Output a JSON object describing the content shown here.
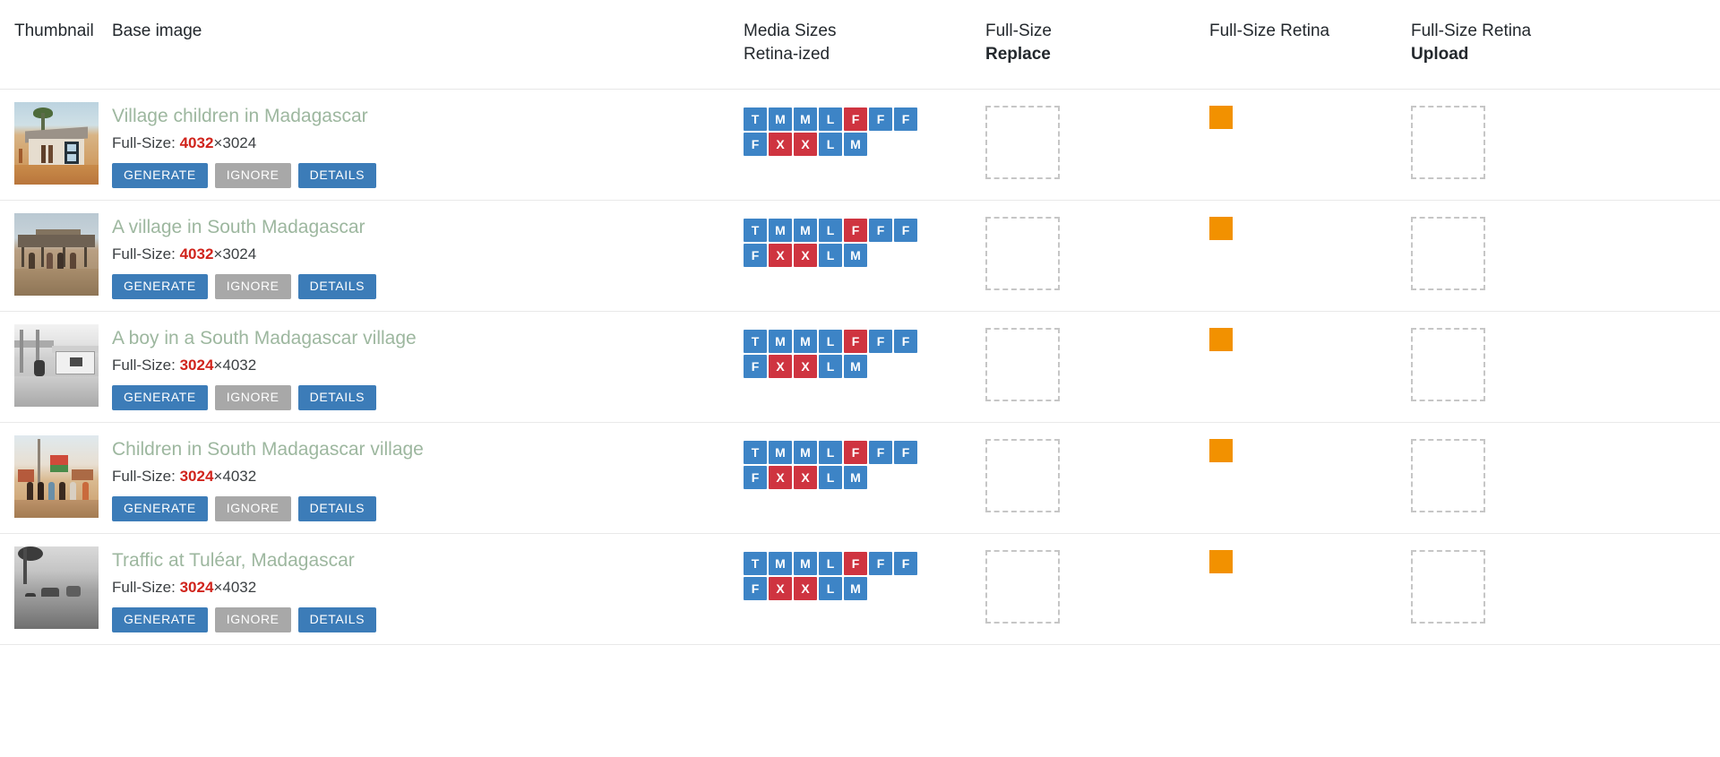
{
  "table": {
    "columns": [
      {
        "id": "thumbnail",
        "label": "Thumbnail",
        "sub": ""
      },
      {
        "id": "base_image",
        "label": "Base image",
        "sub": ""
      },
      {
        "id": "media_sizes",
        "label": "Media Sizes",
        "sub": "Retina-ized"
      },
      {
        "id": "full_size_replace",
        "label": "Full-Size",
        "sub": "Replace"
      },
      {
        "id": "full_size_retina",
        "label": "Full-Size Retina",
        "sub": ""
      },
      {
        "id": "full_size_retina_upload",
        "label": "Full-Size Retina",
        "sub": "Upload"
      }
    ],
    "buttons": {
      "generate": "GENERATE",
      "ignore": "IGNORE",
      "details": "DETAILS"
    },
    "full_size_label": "Full-Size:",
    "dimension_separator": "×",
    "rows": [
      {
        "title": "Village children in Madagascar",
        "full_size_width": "4032",
        "full_size_height": "3024",
        "thumb_style": "t1",
        "thumb_alt": "village-house-thumbnail",
        "badges_row1": [
          {
            "label": "T",
            "state": "ok"
          },
          {
            "label": "M",
            "state": "ok"
          },
          {
            "label": "M",
            "state": "ok"
          },
          {
            "label": "L",
            "state": "ok"
          },
          {
            "label": "F",
            "state": "missing"
          },
          {
            "label": "F",
            "state": "ok"
          },
          {
            "label": "F",
            "state": "ok"
          }
        ],
        "badges_row2": [
          {
            "label": "F",
            "state": "ok"
          },
          {
            "label": "X",
            "state": "missing"
          },
          {
            "label": "X",
            "state": "missing"
          },
          {
            "label": "L",
            "state": "ok"
          },
          {
            "label": "M",
            "state": "ok"
          }
        ],
        "retina_swatch_color": "#f29100"
      },
      {
        "title": "A village in South Madagascar",
        "full_size_width": "4032",
        "full_size_height": "3024",
        "thumb_style": "t2",
        "thumb_alt": "village-market-thumbnail",
        "badges_row1": [
          {
            "label": "T",
            "state": "ok"
          },
          {
            "label": "M",
            "state": "ok"
          },
          {
            "label": "M",
            "state": "ok"
          },
          {
            "label": "L",
            "state": "ok"
          },
          {
            "label": "F",
            "state": "missing"
          },
          {
            "label": "F",
            "state": "ok"
          },
          {
            "label": "F",
            "state": "ok"
          }
        ],
        "badges_row2": [
          {
            "label": "F",
            "state": "ok"
          },
          {
            "label": "X",
            "state": "missing"
          },
          {
            "label": "X",
            "state": "missing"
          },
          {
            "label": "L",
            "state": "ok"
          },
          {
            "label": "M",
            "state": "ok"
          }
        ],
        "retina_swatch_color": "#f29100"
      },
      {
        "title": "A boy in a South Madagascar village",
        "full_size_width": "3024",
        "full_size_height": "4032",
        "thumb_style": "t3",
        "thumb_alt": "boy-village-bw-thumbnail",
        "badges_row1": [
          {
            "label": "T",
            "state": "ok"
          },
          {
            "label": "M",
            "state": "ok"
          },
          {
            "label": "M",
            "state": "ok"
          },
          {
            "label": "L",
            "state": "ok"
          },
          {
            "label": "F",
            "state": "missing"
          },
          {
            "label": "F",
            "state": "ok"
          },
          {
            "label": "F",
            "state": "ok"
          }
        ],
        "badges_row2": [
          {
            "label": "F",
            "state": "ok"
          },
          {
            "label": "X",
            "state": "missing"
          },
          {
            "label": "X",
            "state": "missing"
          },
          {
            "label": "L",
            "state": "ok"
          },
          {
            "label": "M",
            "state": "ok"
          }
        ],
        "retina_swatch_color": "#f29100"
      },
      {
        "title": "Children in South Madagascar village",
        "full_size_width": "3024",
        "full_size_height": "4032",
        "thumb_style": "t4",
        "thumb_alt": "children-village-thumbnail",
        "badges_row1": [
          {
            "label": "T",
            "state": "ok"
          },
          {
            "label": "M",
            "state": "ok"
          },
          {
            "label": "M",
            "state": "ok"
          },
          {
            "label": "L",
            "state": "ok"
          },
          {
            "label": "F",
            "state": "missing"
          },
          {
            "label": "F",
            "state": "ok"
          },
          {
            "label": "F",
            "state": "ok"
          }
        ],
        "badges_row2": [
          {
            "label": "F",
            "state": "ok"
          },
          {
            "label": "X",
            "state": "missing"
          },
          {
            "label": "X",
            "state": "missing"
          },
          {
            "label": "L",
            "state": "ok"
          },
          {
            "label": "M",
            "state": "ok"
          }
        ],
        "retina_swatch_color": "#f29100"
      },
      {
        "title": "Traffic at Tuléar, Madagascar",
        "full_size_width": "3024",
        "full_size_height": "4032",
        "thumb_style": "t5",
        "thumb_alt": "traffic-tulear-bw-thumbnail",
        "badges_row1": [
          {
            "label": "T",
            "state": "ok"
          },
          {
            "label": "M",
            "state": "ok"
          },
          {
            "label": "M",
            "state": "ok"
          },
          {
            "label": "L",
            "state": "ok"
          },
          {
            "label": "F",
            "state": "missing"
          },
          {
            "label": "F",
            "state": "ok"
          },
          {
            "label": "F",
            "state": "ok"
          }
        ],
        "badges_row2": [
          {
            "label": "F",
            "state": "ok"
          },
          {
            "label": "X",
            "state": "missing"
          },
          {
            "label": "X",
            "state": "missing"
          },
          {
            "label": "L",
            "state": "ok"
          },
          {
            "label": "M",
            "state": "ok"
          }
        ],
        "retina_swatch_color": "#f29100"
      }
    ]
  },
  "colors": {
    "badge_ok": "#3d84c6",
    "badge_missing": "#cf3440",
    "button_primary": "#3c7cb8",
    "button_muted": "#a8a8a8",
    "title_link": "#9db79f",
    "dimension_highlight": "#d0241c",
    "retina_swatch": "#f29100",
    "dropzone_border": "#c6c6c6"
  }
}
